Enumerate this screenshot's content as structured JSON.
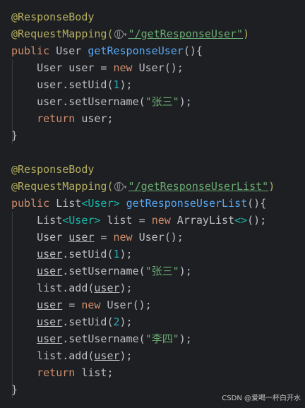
{
  "code": {
    "block1": {
      "ann1": "@ResponseBody",
      "ann2": "@RequestMapping(",
      "url": "\"/getResponseUser\"",
      "ann2_close": ")",
      "kw_public": "public",
      "type_user": "User",
      "method": "getResponseUser",
      "sig_tail": "(){",
      "l1_type": "User",
      "l1_var": "user",
      "l1_eq": " = ",
      "l1_new": "new",
      "l1_ctor": "User();",
      "l2_a": "user.setUid(",
      "l2_num": "1",
      "l2_b": ");",
      "l3_a": "user.setUsername(",
      "l3_str": "\"张三\"",
      "l3_b": ");",
      "l4_ret": "return",
      "l4_val": " user;",
      "close": "}"
    },
    "block2": {
      "ann1": "@ResponseBody",
      "ann2": "@RequestMapping(",
      "url": "\"/getResponseUserList\"",
      "ann2_close": ")",
      "kw_public": "public",
      "type_list": "List",
      "generic": "<User>",
      "method": "getResponseUserList",
      "sig_tail": "(){",
      "l1_list": "List",
      "l1_generic": "<User>",
      "l1_var": " list = ",
      "l1_new": "new",
      "l1_ctor": " ArrayList",
      "l1_diamond": "<>",
      "l1_end": "();",
      "l2_type": "User ",
      "l2_var": "user",
      "l2_eq": " = ",
      "l2_new": "new",
      "l2_ctor": " User();",
      "l3_var": "user",
      "l3_a": ".setUid(",
      "l3_num": "1",
      "l3_b": ");",
      "l4_var": "user",
      "l4_a": ".setUsername(",
      "l4_str": "\"张三\"",
      "l4_b": ");",
      "l5_a": "list.add(",
      "l5_var": "user",
      "l5_b": ");",
      "l6_var": "user",
      "l6_eq": " = ",
      "l6_new": "new",
      "l6_ctor": " User();",
      "l7_var": "user",
      "l7_a": ".setUid(",
      "l7_num": "2",
      "l7_b": ");",
      "l8_var": "user",
      "l8_a": ".setUsername(",
      "l8_str": "\"李四\"",
      "l8_b": ");",
      "l9_a": "list.add(",
      "l9_var": "user",
      "l9_b": ");",
      "l10_ret": "return",
      "l10_val": " list;",
      "close": "}"
    }
  },
  "icons": {
    "web": "globe-icon",
    "chevron": "chevron-down-icon"
  },
  "watermark": "CSDN @爱喝一杯白开水",
  "colors": {
    "background": "#1e1f22",
    "annotation": "#b3ae60",
    "keyword": "#cf8e6d",
    "method": "#56a8f5",
    "string": "#6aab73",
    "number": "#2aacb8"
  }
}
